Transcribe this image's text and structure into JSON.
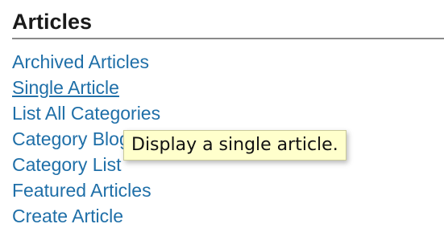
{
  "section": {
    "heading": "Articles"
  },
  "menu": {
    "items": [
      {
        "label": "Archived Articles"
      },
      {
        "label": "Single Article"
      },
      {
        "label": "List All Categories"
      },
      {
        "label": "Category Blog"
      },
      {
        "label": "Category List"
      },
      {
        "label": "Featured Articles"
      },
      {
        "label": "Create Article"
      }
    ],
    "hovered_item": "Single Article"
  },
  "tooltip": {
    "text": "Display a single article."
  },
  "colors": {
    "link": "#1f6fa8",
    "tooltip_background": "#ffffcc",
    "divider": "#8a8a8a"
  }
}
